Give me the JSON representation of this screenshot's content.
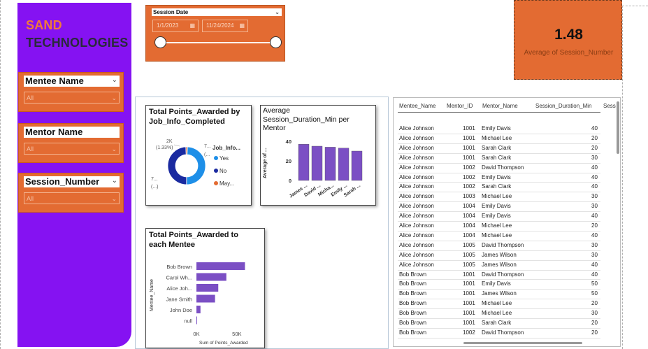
{
  "brand": {
    "line1": "SAND",
    "line2": "TECHNOLOGIES"
  },
  "slicers": [
    {
      "title": "Mentee Name",
      "value": "All"
    },
    {
      "title": "Mentor Name",
      "value": "All"
    },
    {
      "title": "Session_Number",
      "value": "All"
    }
  ],
  "date_slicer": {
    "title": "Session Date",
    "start": "1/1/2023",
    "end": "11/24/2024"
  },
  "kpi": {
    "value": "1.48",
    "label": "Average of Session_Number"
  },
  "donut": {
    "title_line1": "Total Points_Awarded by",
    "title_line2": "Job_Info_Completed",
    "legend_title": "Job_Info...",
    "legend": [
      "Yes",
      "No",
      "May..."
    ],
    "label_top1": "2K",
    "label_top2": "(1.33%)",
    "label_right1": "7...",
    "label_right2": "(...",
    "label_left1": "7...",
    "label_left2": "(...)"
  },
  "bar_v": {
    "title_line1": "Average",
    "title_line2": "Session_Duration_Min per",
    "title_line3": "Mentor",
    "ylabel": "Average of ...",
    "ticks": [
      "40",
      "20",
      "0"
    ],
    "categories": [
      "James ...",
      "David ...",
      "Micha...",
      "Emily ...",
      "Sarah ..."
    ]
  },
  "bar_h": {
    "title_line1": "Total Points_Awarded to",
    "title_line2": "each Mentee",
    "ylabel": "Mentee_Name",
    "xlabel": "Sum of Points_Awarded",
    "ticks": [
      "0K",
      "50K"
    ],
    "categories": [
      "Bob Brown",
      "Carol Wh...",
      "Alice Joh...",
      "Jane Smith",
      "John Doe",
      "null"
    ]
  },
  "chart_data": [
    {
      "type": "pie",
      "categories": [
        "Yes",
        "No",
        "May..."
      ],
      "values": [
        49.5,
        49.17,
        1.33
      ],
      "title": "Total Points_Awarded by Job_Info_Completed"
    },
    {
      "type": "bar",
      "categories": [
        "James ...",
        "David ...",
        "Micha...",
        "Emily ...",
        "Sarah ..."
      ],
      "values": [
        37,
        35,
        34,
        33,
        30
      ],
      "title": "Average Session_Duration_Min per Mentor",
      "xlabel": "",
      "ylabel": "Average of ...",
      "ylim": [
        0,
        40
      ]
    },
    {
      "type": "bar",
      "categories": [
        "Bob Brown",
        "Carol Wh...",
        "Alice Joh...",
        "Jane Smith",
        "John Doe",
        "null"
      ],
      "values": [
        60000,
        37000,
        27000,
        23000,
        5000,
        500
      ],
      "title": "Total Points_Awarded to each Mentee",
      "xlabel": "Sum of Points_Awarded",
      "ylabel": "Mentee_Name",
      "xlim": [
        0,
        70000
      ]
    }
  ],
  "colors": {
    "sidebar": "#8512f2",
    "orange": "#e36b32",
    "bar": "#7b4fc4",
    "donut_yes": "#1e8fe8",
    "donut_no": "#1a2aa0",
    "donut_maybe": "#e36b32"
  },
  "table": {
    "headers": [
      "Mentee_Name",
      "Mentor_ID",
      "Mentor_Name",
      "Session_Duration_Min",
      "Sess"
    ],
    "rows": [
      [
        "Alice Johnson",
        "1001",
        "Emily Davis",
        "40"
      ],
      [
        "Alice Johnson",
        "1001",
        "Michael Lee",
        "20"
      ],
      [
        "Alice Johnson",
        "1001",
        "Sarah Clark",
        "20"
      ],
      [
        "Alice Johnson",
        "1001",
        "Sarah Clark",
        "30"
      ],
      [
        "Alice Johnson",
        "1002",
        "David Thompson",
        "40"
      ],
      [
        "Alice Johnson",
        "1002",
        "Emily Davis",
        "40"
      ],
      [
        "Alice Johnson",
        "1002",
        "Sarah Clark",
        "40"
      ],
      [
        "Alice Johnson",
        "1003",
        "Michael Lee",
        "30"
      ],
      [
        "Alice Johnson",
        "1004",
        "Emily Davis",
        "30"
      ],
      [
        "Alice Johnson",
        "1004",
        "Emily Davis",
        "40"
      ],
      [
        "Alice Johnson",
        "1004",
        "Michael Lee",
        "20"
      ],
      [
        "Alice Johnson",
        "1004",
        "Michael Lee",
        "40"
      ],
      [
        "Alice Johnson",
        "1005",
        "David Thompson",
        "30"
      ],
      [
        "Alice Johnson",
        "1005",
        "James Wilson",
        "30"
      ],
      [
        "Alice Johnson",
        "1005",
        "James Wilson",
        "40"
      ],
      [
        "Bob Brown",
        "1001",
        "David Thompson",
        "40"
      ],
      [
        "Bob Brown",
        "1001",
        "Emily Davis",
        "50"
      ],
      [
        "Bob Brown",
        "1001",
        "James Wilson",
        "50"
      ],
      [
        "Bob Brown",
        "1001",
        "Michael Lee",
        "20"
      ],
      [
        "Bob Brown",
        "1001",
        "Michael Lee",
        "30"
      ],
      [
        "Bob Brown",
        "1001",
        "Sarah Clark",
        "20"
      ],
      [
        "Bob Brown",
        "1002",
        "David Thompson",
        "20"
      ]
    ]
  }
}
